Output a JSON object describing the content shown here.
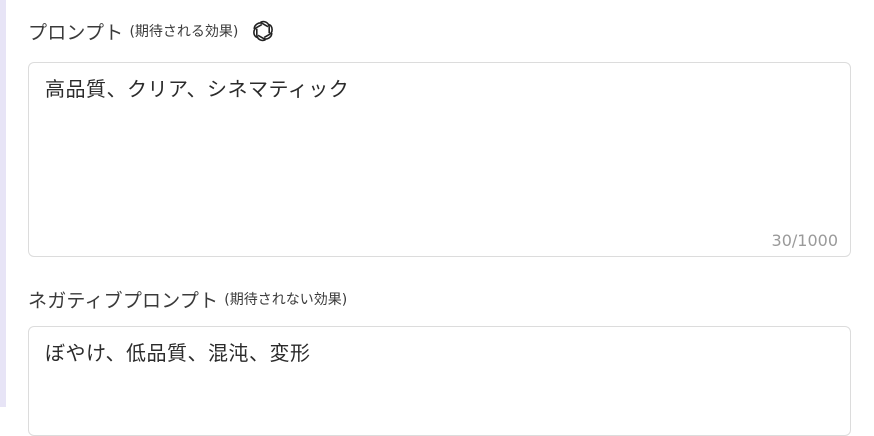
{
  "prompt": {
    "label": "プロンプト",
    "sublabel": "(期待される効果)",
    "icon": "openai-icon",
    "value": "高品質、クリア、シネマティック",
    "char_count": "30/1000"
  },
  "negative_prompt": {
    "label": "ネガティブプロンプト",
    "sublabel": "(期待されない効果)",
    "value": "ぼやけ、低品質、混沌、変形"
  }
}
